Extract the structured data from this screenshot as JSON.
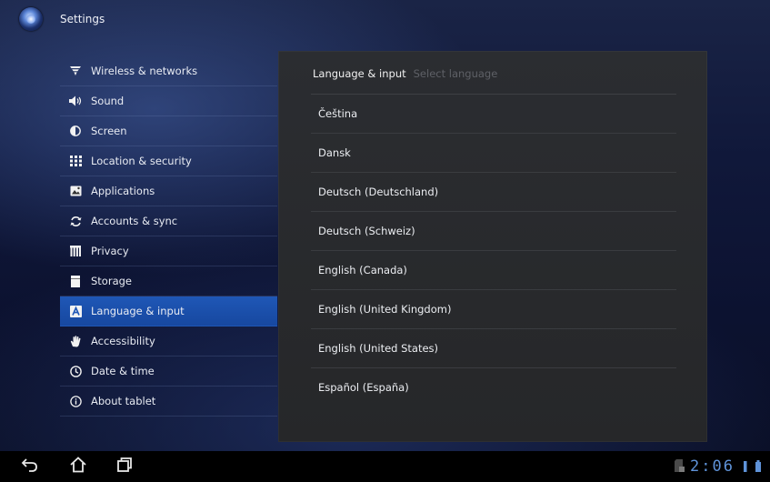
{
  "titlebar": {
    "title": "Settings",
    "icon": "settings-app-icon"
  },
  "sidebar": {
    "items": [
      {
        "label": "Wireless & networks",
        "icon": "wifi-icon"
      },
      {
        "label": "Sound",
        "icon": "speaker-icon"
      },
      {
        "label": "Screen",
        "icon": "brightness-icon"
      },
      {
        "label": "Location & security",
        "icon": "grid-lock-icon"
      },
      {
        "label": "Applications",
        "icon": "apps-icon"
      },
      {
        "label": "Accounts & sync",
        "icon": "sync-icon"
      },
      {
        "label": "Privacy",
        "icon": "privacy-icon"
      },
      {
        "label": "Storage",
        "icon": "sd-card-icon"
      },
      {
        "label": "Language & input",
        "icon": "language-icon",
        "selected": true
      },
      {
        "label": "Accessibility",
        "icon": "hand-icon"
      },
      {
        "label": "Date & time",
        "icon": "clock-icon"
      },
      {
        "label": "About tablet",
        "icon": "info-icon"
      }
    ]
  },
  "panel": {
    "breadcrumb": "Language & input",
    "subtitle": "Select language",
    "languages": [
      "Čeština",
      "Dansk",
      "Deutsch (Deutschland)",
      "Deutsch (Schweiz)",
      "English (Canada)",
      "English (United Kingdom)",
      "English (United States)",
      "Español (España)"
    ]
  },
  "navbar": {
    "back": "back-icon",
    "home": "home-icon",
    "recents": "recent-apps-icon"
  },
  "status": {
    "time": "2:06"
  },
  "colors": {
    "selection": "#1f57b6",
    "clock": "#5f93d9",
    "panel": "#2b2d31"
  }
}
